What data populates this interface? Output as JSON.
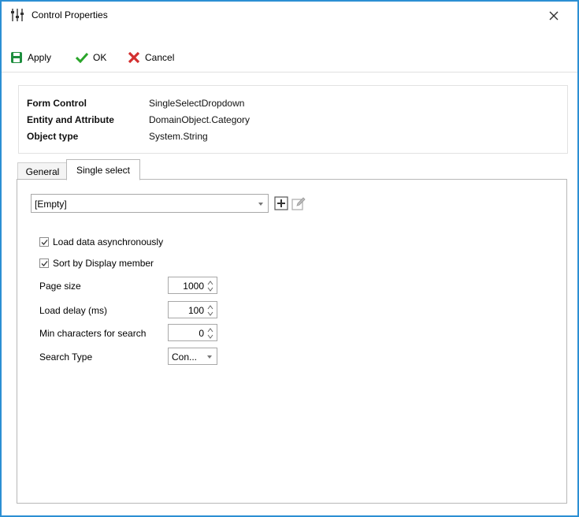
{
  "window": {
    "title": "Control Properties",
    "accent_color": "#2b8fd3"
  },
  "toolbar": {
    "apply_label": "Apply",
    "ok_label": "OK",
    "cancel_label": "Cancel",
    "apply_color": "#1e8e3e",
    "ok_color": "#2aa52a",
    "cancel_color": "#d32f2f"
  },
  "info": {
    "rows": [
      {
        "key": "Form Control",
        "value": "SingleSelectDropdown"
      },
      {
        "key": "Entity and Attribute",
        "value": "DomainObject.Category"
      },
      {
        "key": "Object type",
        "value": "System.String"
      }
    ]
  },
  "tabs": [
    {
      "label": "General",
      "active": false
    },
    {
      "label": "Single select",
      "active": true
    }
  ],
  "single_select": {
    "source_value": "[Empty]",
    "load_async": {
      "label": "Load data asynchronously",
      "checked": true
    },
    "sort_display": {
      "label": "Sort by Display member",
      "checked": true
    },
    "page_size": {
      "label": "Page size",
      "value": "1000"
    },
    "load_delay": {
      "label": "Load delay (ms)",
      "value": "100"
    },
    "min_chars": {
      "label": "Min characters for search",
      "value": "0"
    },
    "search_type": {
      "label": "Search Type",
      "value": "Con..."
    }
  }
}
